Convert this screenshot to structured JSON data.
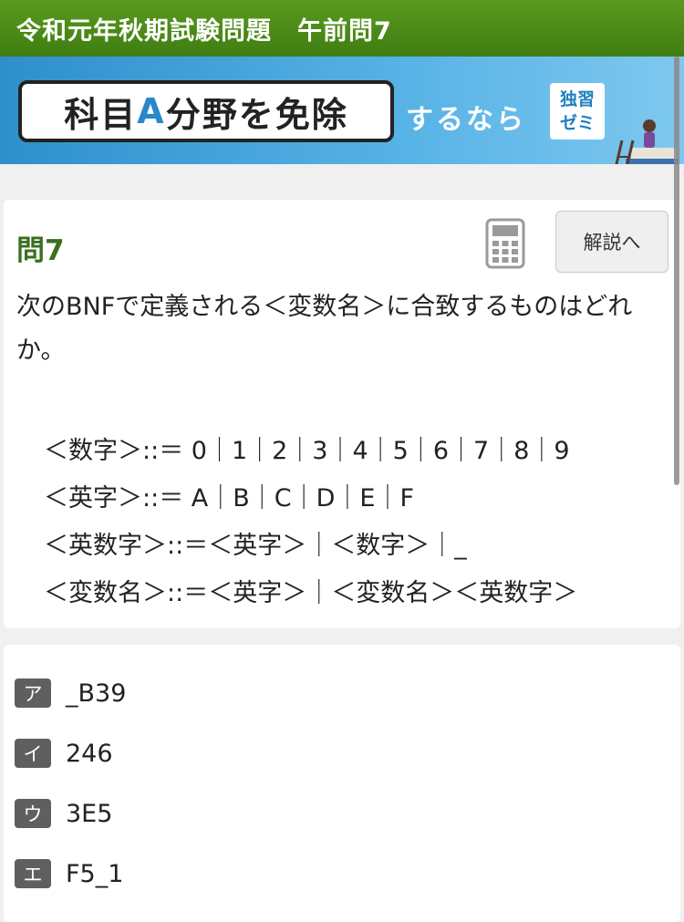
{
  "header": {
    "title": "令和元年秋期試験問題　午前問7"
  },
  "banner": {
    "box_text_1": "科目",
    "box_accent": "A",
    "box_text_2": "分野を免除",
    "suffix": "するなら",
    "brand_line1": "独習",
    "brand_line2": "ゼミ"
  },
  "question": {
    "number_label": "問7",
    "explain_button": "解説へ",
    "calc_icon": "calculator-icon",
    "text": "次のBNFで定義される＜変数名＞に合致するものはどれか。",
    "bnf": [
      "＜数字＞::＝ 0｜1｜2｜3｜4｜5｜6｜7｜8｜9",
      "＜英字＞::＝ A｜B｜C｜D｜E｜F",
      "＜英数字＞::＝＜英字＞｜＜数字＞｜_",
      "＜変数名＞::＝＜英字＞｜＜変数名＞＜英数字＞"
    ]
  },
  "choices": [
    {
      "label": "ア",
      "text": "_B39"
    },
    {
      "label": "イ",
      "text": "246"
    },
    {
      "label": "ウ",
      "text": "3E5"
    },
    {
      "label": "エ",
      "text": "F5_1"
    }
  ],
  "colors": {
    "header_green": "#4a8a18",
    "title_green": "#3c6e1f",
    "banner_blue": "#2e8fcb",
    "choice_label_bg": "#5f5f5f"
  }
}
